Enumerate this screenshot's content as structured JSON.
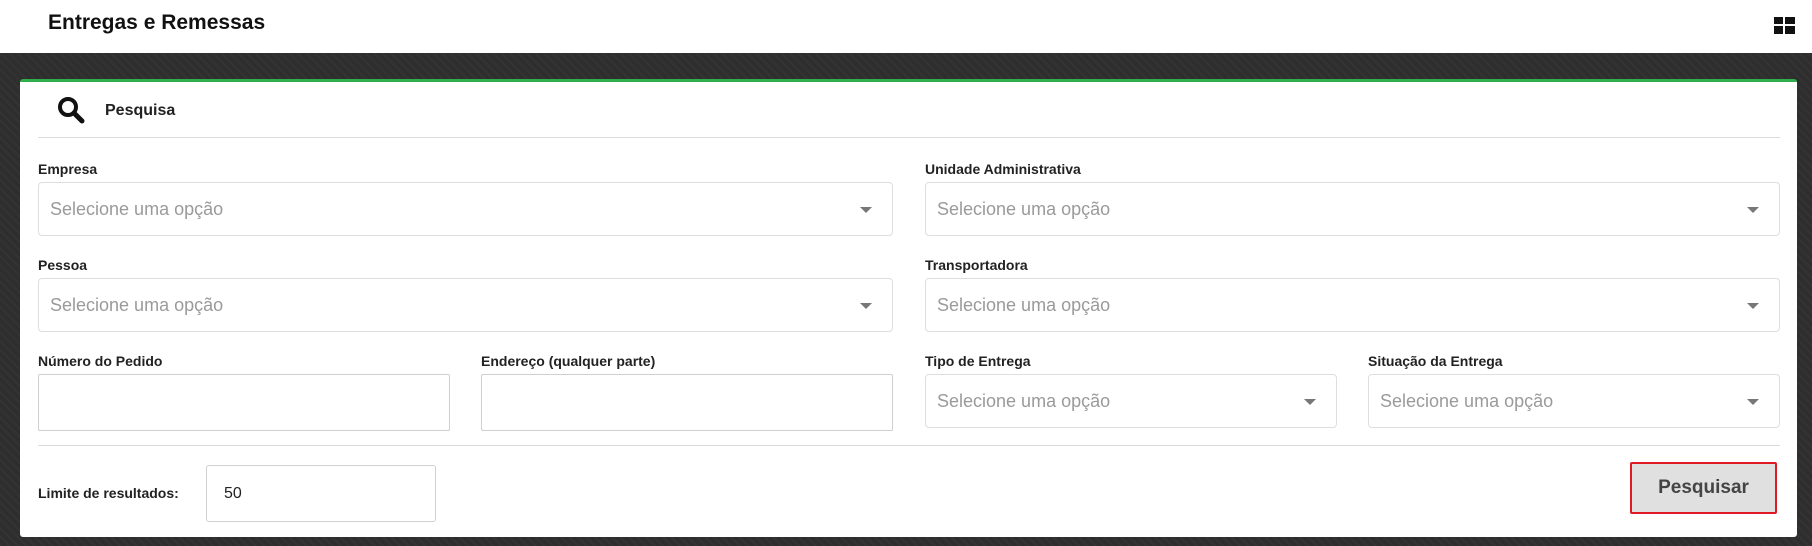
{
  "header": {
    "title": "Entregas e Remessas",
    "menu_icon": "grid-icon"
  },
  "panel": {
    "title": "Pesquisa",
    "title_icon": "search-icon",
    "accent_color": "#2fae4b"
  },
  "filters": {
    "empresa": {
      "label": "Empresa",
      "placeholder": "Selecione uma opção"
    },
    "unidade": {
      "label": "Unidade Administrativa",
      "placeholder": "Selecione uma opção"
    },
    "pessoa": {
      "label": "Pessoa",
      "placeholder": "Selecione uma opção"
    },
    "transportadora": {
      "label": "Transportadora",
      "placeholder": "Selecione uma opção"
    },
    "numero_pedido": {
      "label": "Número do Pedido",
      "value": ""
    },
    "endereco": {
      "label": "Endereço (qualquer parte)",
      "value": ""
    },
    "tipo_entrega": {
      "label": "Tipo de Entrega",
      "placeholder": "Selecione uma opção"
    },
    "situacao_entrega": {
      "label": "Situação da Entrega",
      "placeholder": "Selecione uma opção"
    }
  },
  "footer": {
    "limit_label": "Limite de resultados:",
    "limit_value": "50",
    "search_button": "Pesquisar"
  }
}
